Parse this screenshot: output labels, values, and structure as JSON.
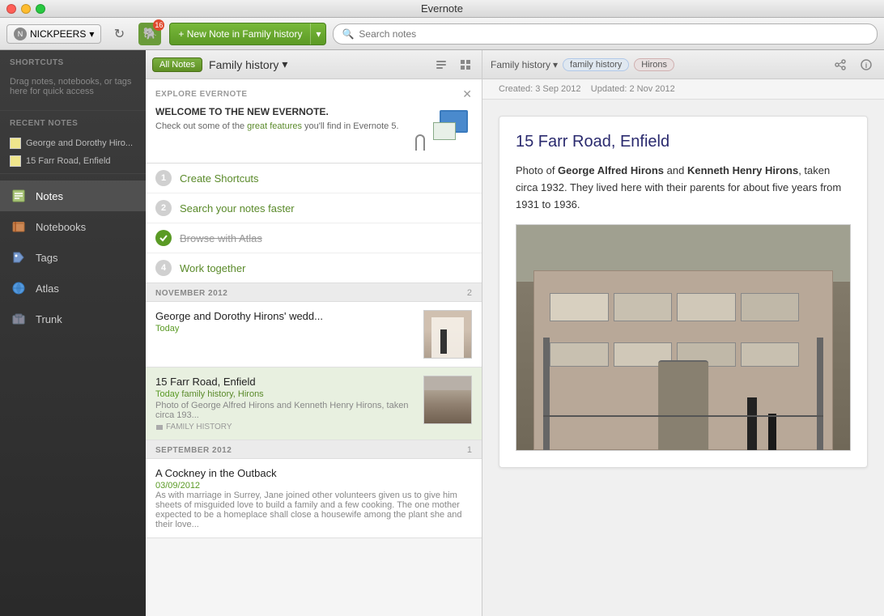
{
  "titlebar": {
    "title": "Evernote"
  },
  "toolbar": {
    "user_label": "NICKPEERS",
    "new_note_label": "+ New Note in Family history",
    "new_note_arrow": "▾",
    "search_placeholder": "Search notes",
    "elephant_badge": "16"
  },
  "sidebar": {
    "shortcuts_title": "SHORTCUTS",
    "shortcuts_desc": "Drag notes, notebooks, or tags here for quick access",
    "recent_title": "RECENT NOTES",
    "recent_notes": [
      {
        "label": "George and Dorothy Hiro..."
      },
      {
        "label": "15 Farr Road, Enfield"
      }
    ],
    "nav_items": [
      {
        "id": "notes",
        "label": "Notes",
        "active": true
      },
      {
        "id": "notebooks",
        "label": "Notebooks"
      },
      {
        "id": "tags",
        "label": "Tags"
      },
      {
        "id": "atlas",
        "label": "Atlas"
      },
      {
        "id": "trunk",
        "label": "Trunk"
      }
    ]
  },
  "notes_panel": {
    "all_notes_btn": "All Notes",
    "notebook_title": "Family history",
    "notebook_arrow": "▾",
    "explore_title": "EXPLORE EVERNOTE",
    "welcome_title": "WELCOME TO THE NEW EVERNOTE.",
    "welcome_desc_plain": "Check out some of the ",
    "welcome_desc_link": "great features",
    "welcome_desc_end": " you'll find in Evernote 5.",
    "steps": [
      {
        "num": "1",
        "label": "Create Shortcuts",
        "done": false
      },
      {
        "num": "2",
        "label": "Search your notes faster",
        "done": false
      },
      {
        "num": "3",
        "label": "Browse with Atlas",
        "done": true
      },
      {
        "num": "4",
        "label": "Work together",
        "done": false
      }
    ],
    "sections": [
      {
        "month": "NOVEMBER 2012",
        "count": "2",
        "notes": [
          {
            "id": "note1",
            "title": "George and Dorothy Hirons' wedd...",
            "date": "Today",
            "tags": "",
            "snippet": "",
            "has_thumb": true,
            "selected": false
          },
          {
            "id": "note2",
            "title": "15 Farr Road, Enfield",
            "date": "Today",
            "tags": "family history, Hirons",
            "snippet": "Photo of George Alfred Hirons and Kenneth Henry Hirons, taken circa 193...",
            "has_thumb": true,
            "selected": true,
            "notebook": "FAMILY HISTORY"
          }
        ]
      },
      {
        "month": "SEPTEMBER 2012",
        "count": "1",
        "notes": [
          {
            "id": "note3",
            "title": "A Cockney in the Outback",
            "date": "03/09/2012",
            "tags": "",
            "snippet": "As with marriage in Surrey, Jane joined other volunteers given us to give him sheets of misguided love to build a family and a few cooking. The one mother expected to be a homeplace shall close a housewife among the plant she and their love...",
            "has_thumb": false,
            "selected": false
          }
        ]
      }
    ]
  },
  "note_detail": {
    "breadcrumb_notebook": "Family history",
    "breadcrumb_arrow": "▾",
    "tag_family_history": "family history",
    "tag_hirons": "Hirons",
    "meta_created": "Created: 3 Sep 2012",
    "meta_updated": "Updated: 2 Nov 2012",
    "title": "15 Farr Road, Enfield",
    "body_intro": "Photo of ",
    "body_name1": "George Alfred Hirons",
    "body_mid": " and ",
    "body_name2": "Kenneth Henry Hirons",
    "body_end": ", taken circa 1932. They lived here with their parents for about five years from 1931 to 1936."
  },
  "colors": {
    "green_accent": "#5a9a25",
    "blue_link": "#2a2a8e",
    "sidebar_bg": "#333333",
    "tag_purple_bg": "#e8e0f0"
  }
}
